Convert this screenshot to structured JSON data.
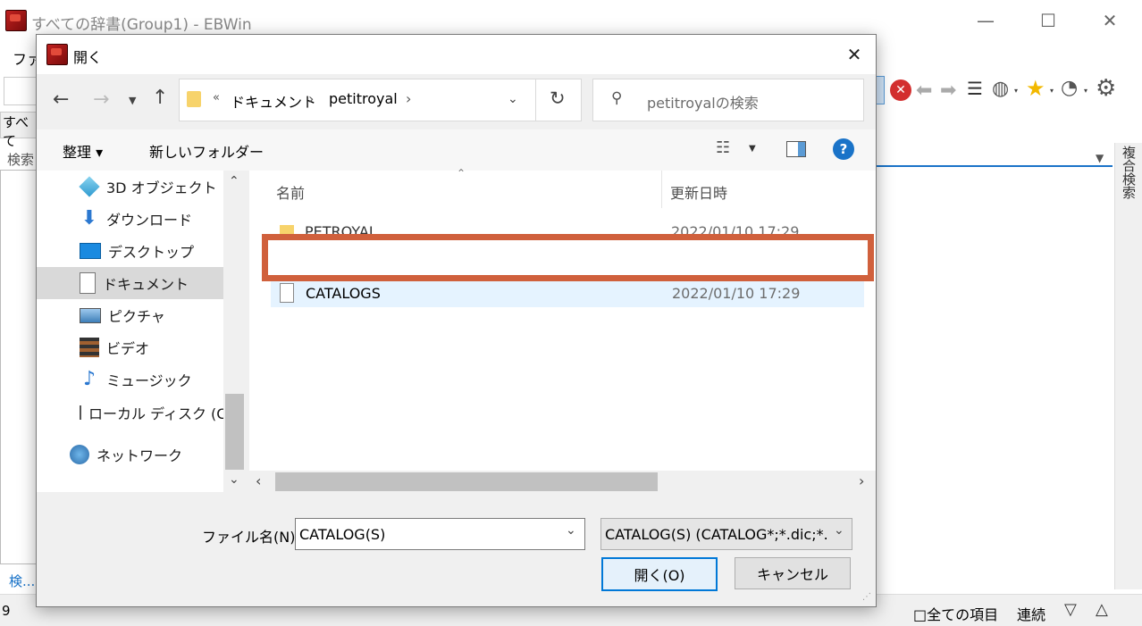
{
  "main_window": {
    "title": "すべての辞書(Group1) - EBWin",
    "menu_partial": "ファ",
    "group_partial": "すべて",
    "search_label_partial": "検索",
    "right_panel_label": "複合検索",
    "bottom_left_link": "検...",
    "status_number": "9",
    "all_items_label": "□全ての項目",
    "continuous_label": "連続",
    "nav_down": "▽",
    "nav_up": "△",
    "minimize": "—",
    "maximize": "☐",
    "close": "✕"
  },
  "dialog": {
    "title": "開く",
    "close": "✕",
    "breadcrumb": {
      "overflow": "«",
      "parts": [
        "ドキュメント",
        "petitroyal"
      ],
      "sep": "›"
    },
    "search_placeholder": "petitroyalの検索",
    "organize_label": "整理 ▾",
    "new_folder_label": "新しいフォルダー",
    "help": "?",
    "nav_items": [
      {
        "label": "3D オブジェクト",
        "icon": "3d-objects-icon"
      },
      {
        "label": "ダウンロード",
        "icon": "download-icon"
      },
      {
        "label": "デスクトップ",
        "icon": "desktop-icon"
      },
      {
        "label": "ドキュメント",
        "icon": "documents-icon"
      },
      {
        "label": "ピクチャ",
        "icon": "pictures-icon"
      },
      {
        "label": "ビデオ",
        "icon": "videos-icon"
      },
      {
        "label": "ミュージック",
        "icon": "music-icon"
      },
      {
        "label": "ローカル ディスク (C",
        "icon": "local-disk-icon"
      },
      {
        "label": "ネットワーク",
        "icon": "network-icon"
      }
    ],
    "columns": {
      "name": "名前",
      "modified": "更新日時"
    },
    "files": [
      {
        "name": "PETROYAL",
        "modified": "2022/01/10 17:29",
        "type": "folder"
      },
      {
        "name": "CATALOGS",
        "modified": "2022/01/10 17:29",
        "type": "file"
      }
    ],
    "filename_label": "ファイル名(N):",
    "filename_value": "CATALOG(S)",
    "filetype_value": "CATALOG(S) (CATALOG*;*.dic;*.i",
    "open_button": "開く(O)",
    "cancel_button": "キャンセル"
  },
  "colors": {
    "highlight_border": "#d0603c",
    "selected_row": "#e5f3ff",
    "help_blue": "#1a73c8"
  }
}
